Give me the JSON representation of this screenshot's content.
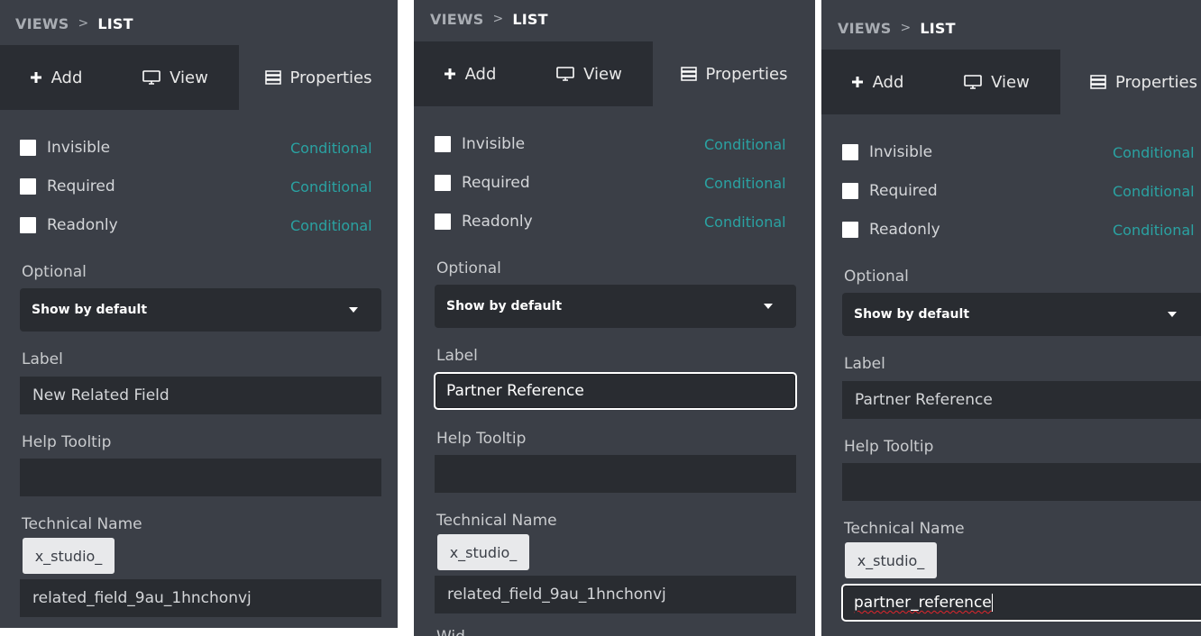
{
  "breadcrumb": {
    "root": "VIEWS",
    "separator": ">",
    "current": "LIST"
  },
  "tabs": {
    "add": "Add",
    "view": "View",
    "properties": "Properties"
  },
  "checkboxes": [
    {
      "label": "Invisible",
      "link": "Conditional",
      "checked": false
    },
    {
      "label": "Required",
      "link": "Conditional",
      "checked": false
    },
    {
      "label": "Readonly",
      "link": "Conditional",
      "checked": false
    }
  ],
  "optional": {
    "label": "Optional",
    "selected": "Show by default"
  },
  "label_field": {
    "label": "Label"
  },
  "help_tooltip": {
    "label": "Help Tooltip",
    "value": ""
  },
  "technical_name": {
    "label": "Technical Name",
    "prefix": "x_studio_"
  },
  "panels": [
    {
      "label_value": "New Related Field",
      "technical_value": "related_field_9au_1hnchonvj"
    },
    {
      "label_value": "Partner Reference",
      "technical_value": "related_field_9au_1hnchonvj",
      "next_label_partial": "Wid"
    },
    {
      "label_value": "Partner Reference",
      "technical_value": "partner_reference"
    }
  ],
  "colors": {
    "panel_bg": "#3b3f47",
    "tabbar_bg": "#2a2d33",
    "input_bg": "#292c31",
    "accent_teal": "#2aa2a2"
  }
}
